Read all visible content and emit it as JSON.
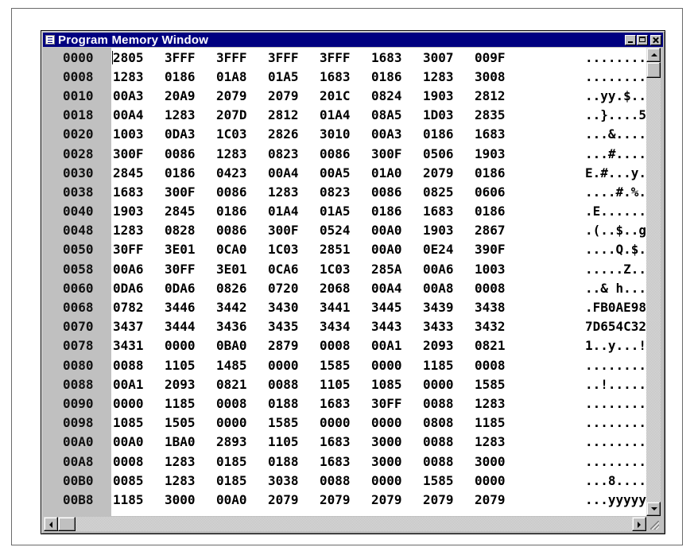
{
  "window": {
    "title": "Program Memory Window"
  },
  "memory": {
    "rows": [
      {
        "addr": "0000",
        "words": [
          "2805",
          "3FFF",
          "3FFF",
          "3FFF",
          "3FFF",
          "1683",
          "3007",
          "009F"
        ],
        "ascii": "........"
      },
      {
        "addr": "0008",
        "words": [
          "1283",
          "0186",
          "01A8",
          "01A5",
          "1683",
          "0186",
          "1283",
          "3008"
        ],
        "ascii": "........"
      },
      {
        "addr": "0010",
        "words": [
          "00A3",
          "20A9",
          "2079",
          "2079",
          "201C",
          "0824",
          "1903",
          "2812"
        ],
        "ascii": "..yy.$.."
      },
      {
        "addr": "0018",
        "words": [
          "00A4",
          "1283",
          "207D",
          "2812",
          "01A4",
          "08A5",
          "1D03",
          "2835"
        ],
        "ascii": "..}....5"
      },
      {
        "addr": "0020",
        "words": [
          "1003",
          "0DA3",
          "1C03",
          "2826",
          "3010",
          "00A3",
          "0186",
          "1683"
        ],
        "ascii": "...&...."
      },
      {
        "addr": "0028",
        "words": [
          "300F",
          "0086",
          "1283",
          "0823",
          "0086",
          "300F",
          "0506",
          "1903"
        ],
        "ascii": "...#...."
      },
      {
        "addr": "0030",
        "words": [
          "2845",
          "0186",
          "0423",
          "00A4",
          "00A5",
          "01A0",
          "2079",
          "0186"
        ],
        "ascii": "E.#...y."
      },
      {
        "addr": "0038",
        "words": [
          "1683",
          "300F",
          "0086",
          "1283",
          "0823",
          "0086",
          "0825",
          "0606"
        ],
        "ascii": "....#.%."
      },
      {
        "addr": "0040",
        "words": [
          "1903",
          "2845",
          "0186",
          "01A4",
          "01A5",
          "0186",
          "1683",
          "0186"
        ],
        "ascii": ".E......"
      },
      {
        "addr": "0048",
        "words": [
          "1283",
          "0828",
          "0086",
          "300F",
          "0524",
          "00A0",
          "1903",
          "2867"
        ],
        "ascii": ".(..$..g"
      },
      {
        "addr": "0050",
        "words": [
          "30FF",
          "3E01",
          "0CA0",
          "1C03",
          "2851",
          "00A0",
          "0E24",
          "390F"
        ],
        "ascii": "....Q.$."
      },
      {
        "addr": "0058",
        "words": [
          "00A6",
          "30FF",
          "3E01",
          "0CA6",
          "1C03",
          "285A",
          "00A6",
          "1003"
        ],
        "ascii": ".....Z.."
      },
      {
        "addr": "0060",
        "words": [
          "0DA6",
          "0DA6",
          "0826",
          "0720",
          "2068",
          "00A4",
          "00A8",
          "0008"
        ],
        "ascii": "..& h..."
      },
      {
        "addr": "0068",
        "words": [
          "0782",
          "3446",
          "3442",
          "3430",
          "3441",
          "3445",
          "3439",
          "3438"
        ],
        "ascii": ".FB0AE98"
      },
      {
        "addr": "0070",
        "words": [
          "3437",
          "3444",
          "3436",
          "3435",
          "3434",
          "3443",
          "3433",
          "3432"
        ],
        "ascii": "7D654C32"
      },
      {
        "addr": "0078",
        "words": [
          "3431",
          "0000",
          "0BA0",
          "2879",
          "0008",
          "00A1",
          "2093",
          "0821"
        ],
        "ascii": "1..y...!"
      },
      {
        "addr": "0080",
        "words": [
          "0088",
          "1105",
          "1485",
          "0000",
          "1585",
          "0000",
          "1185",
          "0008"
        ],
        "ascii": "........"
      },
      {
        "addr": "0088",
        "words": [
          "00A1",
          "2093",
          "0821",
          "0088",
          "1105",
          "1085",
          "0000",
          "1585"
        ],
        "ascii": "..!....."
      },
      {
        "addr": "0090",
        "words": [
          "0000",
          "1185",
          "0008",
          "0188",
          "1683",
          "30FF",
          "0088",
          "1283"
        ],
        "ascii": "........"
      },
      {
        "addr": "0098",
        "words": [
          "1085",
          "1505",
          "0000",
          "1585",
          "0000",
          "0000",
          "0808",
          "1185"
        ],
        "ascii": "........"
      },
      {
        "addr": "00A0",
        "words": [
          "00A0",
          "1BA0",
          "2893",
          "1105",
          "1683",
          "3000",
          "0088",
          "1283"
        ],
        "ascii": "........"
      },
      {
        "addr": "00A8",
        "words": [
          "0008",
          "1283",
          "0185",
          "0188",
          "1683",
          "3000",
          "0088",
          "3000"
        ],
        "ascii": "........"
      },
      {
        "addr": "00B0",
        "words": [
          "0085",
          "1283",
          "0185",
          "3038",
          "0088",
          "0000",
          "1585",
          "0000"
        ],
        "ascii": "...8...."
      },
      {
        "addr": "00B8",
        "words": [
          "1185",
          "3000",
          "00A0",
          "2079",
          "2079",
          "2079",
          "2079",
          "2079"
        ],
        "ascii": "...yyyyy"
      }
    ]
  }
}
